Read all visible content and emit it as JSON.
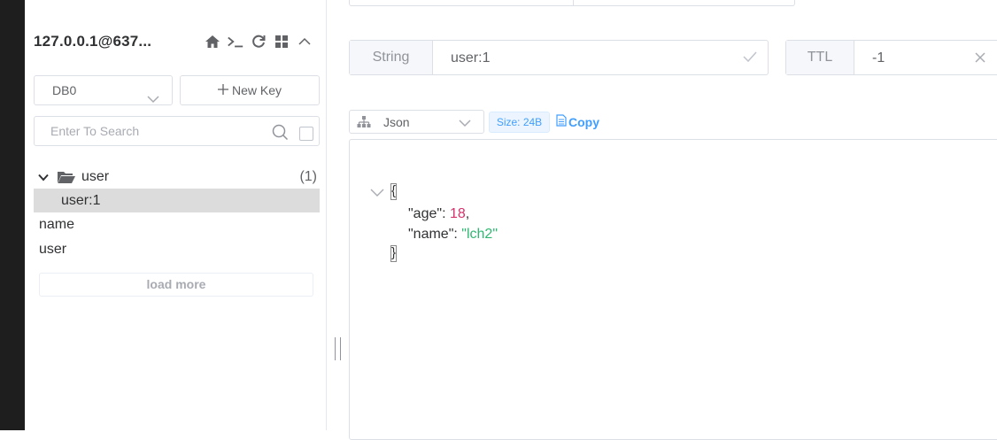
{
  "sidebar": {
    "connection_title": "127.0.0.1@637...",
    "icons": [
      "home-icon",
      "terminal-icon",
      "refresh-icon",
      "grid-icon",
      "chevron-up-icon"
    ],
    "db_select": "DB0",
    "new_key_label": "New Key",
    "search_placeholder": "Enter To Search",
    "tree": {
      "folder_label": "user",
      "folder_count": "(1)",
      "selected_key": "user:1",
      "keys": [
        "name",
        "user"
      ]
    },
    "load_more_label": "load more"
  },
  "key_panel": {
    "type_label": "String",
    "key_name": "user:1",
    "ttl_label": "TTL",
    "ttl_value": "-1"
  },
  "viewer": {
    "format": "Json",
    "size_tag": "Size: 24B",
    "copy_label": "Copy",
    "json_open": "{",
    "json_close": "}",
    "fields": [
      {
        "key": "\"age\"",
        "sep": ": ",
        "value": "18",
        "suffix": ","
      },
      {
        "key": "\"name\"",
        "sep": ": ",
        "value": "\"lch2\"",
        "suffix": ""
      }
    ]
  },
  "colors": {
    "accent": "#409eff",
    "number": "#d6336c",
    "string": "#2fb872",
    "selected_row": "#dcdcdc"
  }
}
